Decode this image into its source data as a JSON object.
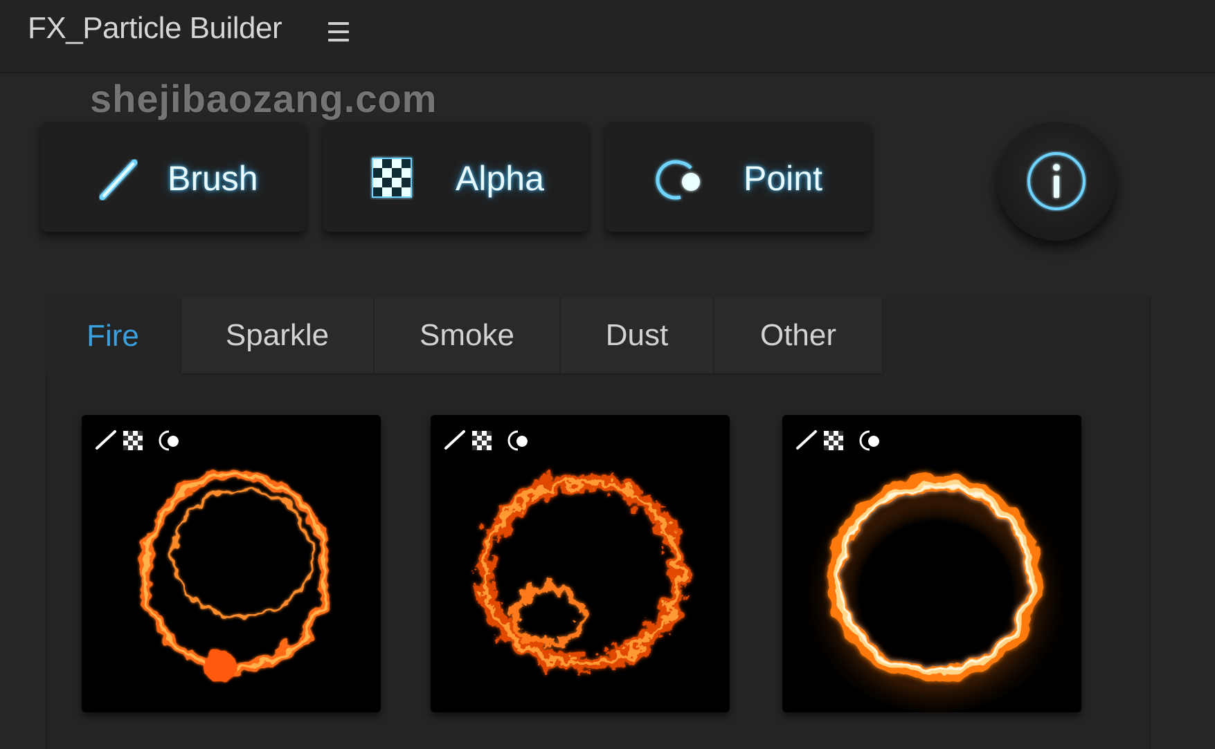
{
  "app": {
    "title": "FX_Particle Builder",
    "menu_icon": "hamburger-menu-icon"
  },
  "watermark": "shejibaozang.com",
  "modes": [
    {
      "label": "Brush",
      "icon": "brush-icon"
    },
    {
      "label": "Alpha",
      "icon": "checkerboard-icon"
    },
    {
      "label": "Point",
      "icon": "point-toggle-icon"
    }
  ],
  "info": {
    "icon": "info-icon"
  },
  "tabs": [
    {
      "label": "Fire",
      "active": true
    },
    {
      "label": "Sparkle",
      "active": false
    },
    {
      "label": "Smoke",
      "active": false
    },
    {
      "label": "Dust",
      "active": false
    },
    {
      "label": "Other",
      "active": false
    }
  ],
  "presets": [
    {
      "name": "fire-ring-1",
      "style": "thin"
    },
    {
      "name": "fire-ring-2",
      "style": "wispy"
    },
    {
      "name": "fire-ring-3",
      "style": "bright"
    }
  ],
  "colors": {
    "accent": "#3aa0e0",
    "glow": "#6fd4ff",
    "fire": "#ff7a1a"
  }
}
